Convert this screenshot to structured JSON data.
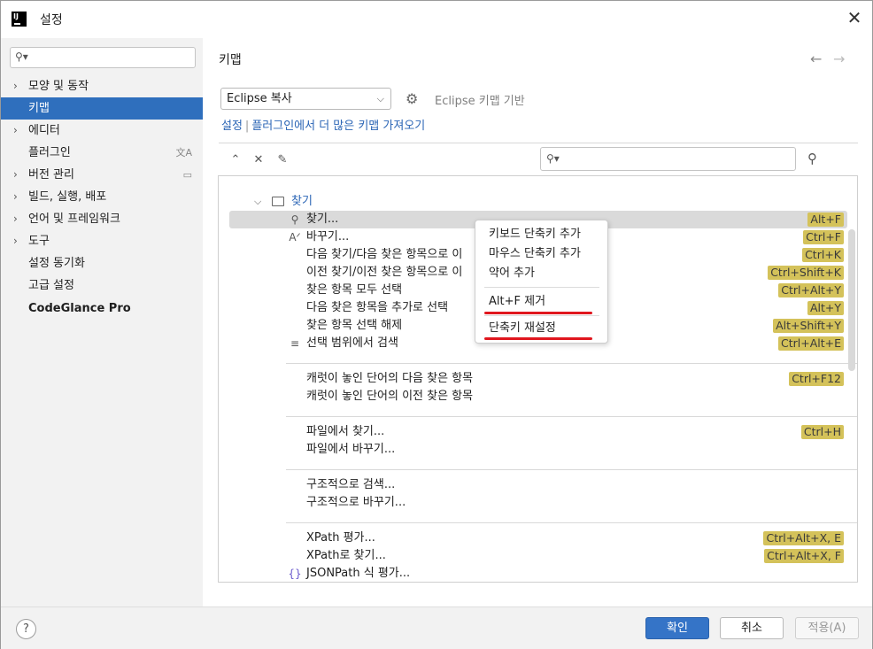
{
  "window": {
    "title": "설정",
    "logo_text": "IJ",
    "close_glyph": "✕"
  },
  "sidebar": {
    "search_placeholder": "",
    "items": [
      {
        "label": "모양 및 동작",
        "expandable": true
      },
      {
        "label": "키맵",
        "selected": true
      },
      {
        "label": "에디터",
        "expandable": true
      },
      {
        "label": "플러그인",
        "right_icon": "translate-icon"
      },
      {
        "label": "버전 관리",
        "expandable": true,
        "right_icon": "window-icon"
      },
      {
        "label": "빌드, 실행, 배포",
        "expandable": true
      },
      {
        "label": "언어 및 프레임워크",
        "expandable": true
      },
      {
        "label": "도구",
        "expandable": true
      },
      {
        "label": "설정 동기화"
      },
      {
        "label": "고급 설정"
      },
      {
        "label": "CodeGlance Pro",
        "bold": true
      }
    ]
  },
  "main": {
    "title": "키맵",
    "keymap_selected": "Eclipse 복사",
    "based_on": "Eclipse 키맵 기반",
    "link_settings": "설정",
    "link_plugins": "플러그인에서 더 많은 키맵 가져오기",
    "filter_placeholder": ""
  },
  "tree": {
    "group_label": "찾기",
    "rows": [
      {
        "label": "찾기...",
        "shortcut": "Alt+F",
        "icon": "search-icon",
        "highlighted": true
      },
      {
        "label": "바꾸기...",
        "shortcut": "Ctrl+F",
        "icon": "replace-icon"
      },
      {
        "label": "다음 찾기/다음 찾은 항목으로 이",
        "shortcut": "Ctrl+K"
      },
      {
        "label": "이전 찾기/이전 찾은 항목으로 이",
        "shortcut": "Ctrl+Shift+K"
      },
      {
        "label": "찾은 항목 모두 선택",
        "shortcut": "Ctrl+Alt+Y"
      },
      {
        "label": "다음 찾은 항목을 추가로 선택",
        "shortcut": "Alt+Y"
      },
      {
        "label": "찾은 항목 선택 해제",
        "shortcut": "Alt+Shift+Y"
      },
      {
        "label": "선택 범위에서 검색",
        "shortcut": "Ctrl+Alt+E",
        "icon": "search-in-selection-icon"
      },
      {
        "label": "캐럿이 놓인 단어의 다음 찾은 항목",
        "shortcut": "Ctrl+F12"
      },
      {
        "label": "캐럿이 놓인 단어의 이전 찾은 항목",
        "shortcut": ""
      },
      {
        "label": "파일에서 찾기...",
        "shortcut": "Ctrl+H"
      },
      {
        "label": "파일에서 바꾸기...",
        "shortcut": ""
      },
      {
        "label": "구조적으로 검색...",
        "shortcut": ""
      },
      {
        "label": "구조적으로 바꾸기...",
        "shortcut": ""
      },
      {
        "label": "XPath 평가...",
        "shortcut": "Ctrl+Alt+X, E"
      },
      {
        "label": "XPath로 찾기...",
        "shortcut": "Ctrl+Alt+X, F"
      },
      {
        "label": "JSONPath 식 평가...",
        "shortcut": "",
        "icon": "braces-icon"
      }
    ]
  },
  "context_menu": {
    "items": [
      "키보드 단축키 추가",
      "마우스 단축키 추가",
      "약어 추가",
      "Alt+F 제거",
      "단축키 재설정"
    ]
  },
  "footer": {
    "help": "?",
    "ok": "확인",
    "cancel": "취소",
    "apply": "적용(A)"
  },
  "colors": {
    "selection": "#2f6fbd",
    "shortcut_badge": "#d4c25a",
    "link": "#2a64b5",
    "annotation_red": "#e0161e",
    "primary_button": "#3574c7"
  }
}
